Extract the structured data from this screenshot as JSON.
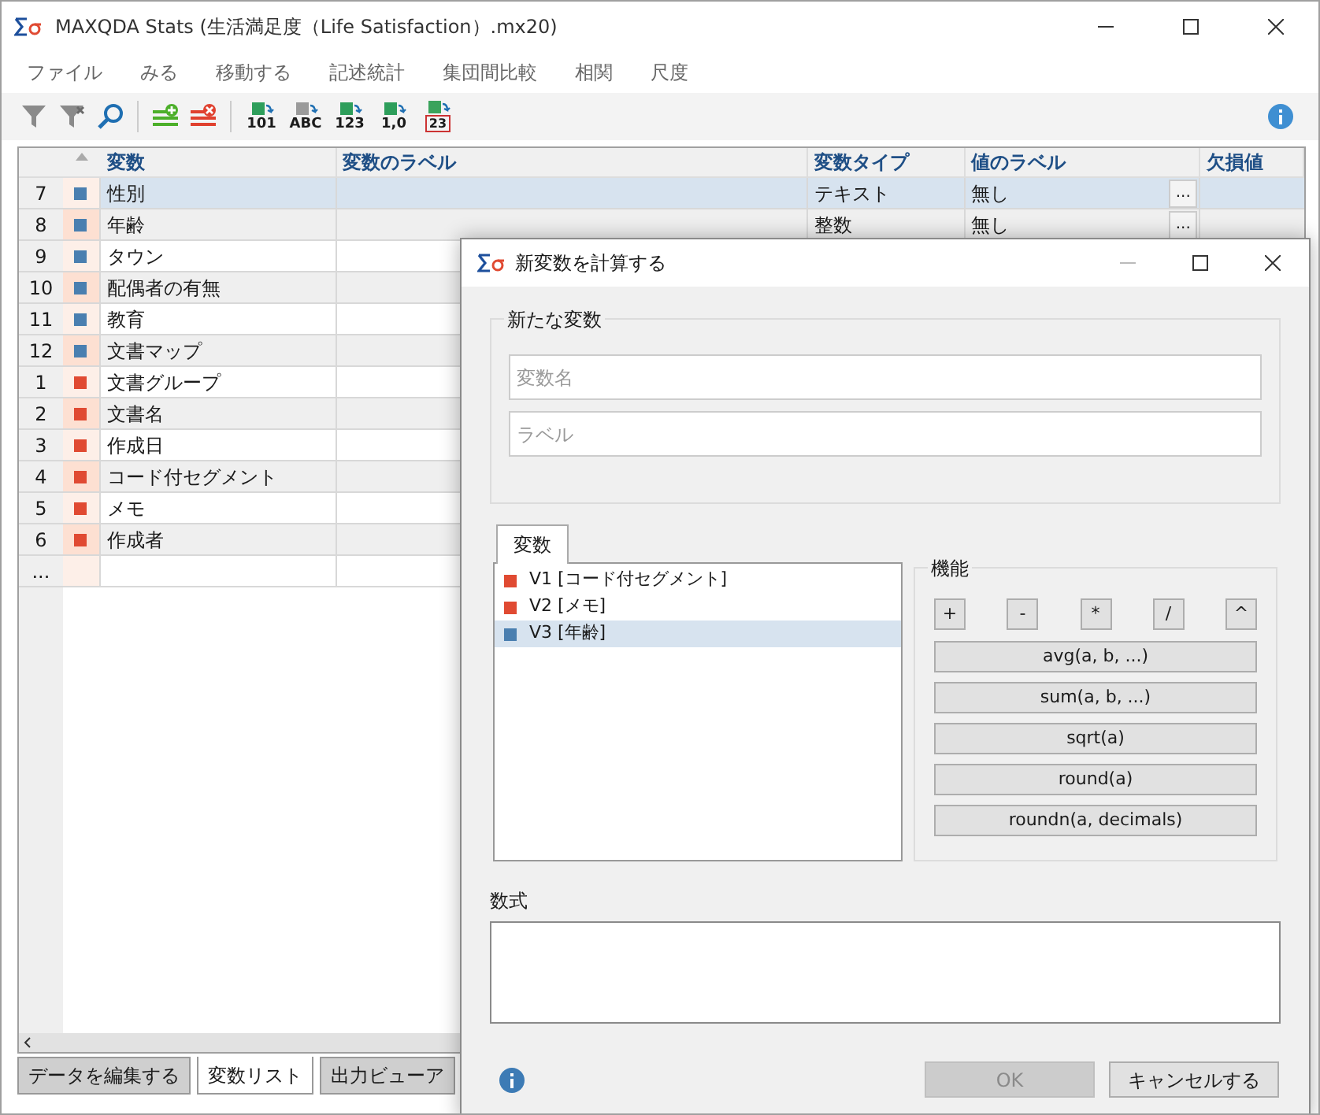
{
  "window": {
    "title": "MAXQDA Stats (生活満足度（Life Satisfaction）.mx20)"
  },
  "menu": [
    "ファイル",
    "みる",
    "移動する",
    "記述統計",
    "集団間比較",
    "相関",
    "尺度"
  ],
  "toolbar": [
    {
      "kind": "filter"
    },
    {
      "kind": "filter-clear"
    },
    {
      "kind": "search"
    },
    {
      "kind": "add"
    },
    {
      "kind": "delete"
    },
    {
      "kind": "convert",
      "label": "101",
      "color": "#2e9e5b"
    },
    {
      "kind": "convert",
      "label": "ABC",
      "color": "#9a9a9a"
    },
    {
      "kind": "convert",
      "label": "123",
      "color": "#2e9e5b"
    },
    {
      "kind": "convert",
      "label": "1,0",
      "color": "#2e9e5b"
    },
    {
      "kind": "date",
      "label": "23"
    }
  ],
  "table": {
    "columns": [
      "変数",
      "変数のラベル",
      "変数タイプ",
      "値のラベル",
      "欠損値"
    ],
    "rows": [
      {
        "num": "7",
        "color": "#4a7fb0",
        "name": "性別",
        "type": "テキスト",
        "value_label": "無し",
        "button": "...",
        "selected": true
      },
      {
        "num": "8",
        "color": "#4a7fb0",
        "name": "年齢",
        "type": "整数",
        "value_label": "無し",
        "button": "...",
        "selected": false
      },
      {
        "num": "9",
        "color": "#4a7fb0",
        "name": "タウン",
        "selected": false
      },
      {
        "num": "10",
        "color": "#4a7fb0",
        "name": "配偶者の有無",
        "selected": false
      },
      {
        "num": "11",
        "color": "#4a7fb0",
        "name": "教育",
        "selected": false
      },
      {
        "num": "12",
        "color": "#4a7fb0",
        "name": "文書マップ",
        "selected": false
      },
      {
        "num": "1",
        "color": "#e04a32",
        "name": "文書グループ",
        "selected": false
      },
      {
        "num": "2",
        "color": "#e04a32",
        "name": "文書名",
        "selected": false
      },
      {
        "num": "3",
        "color": "#e04a32",
        "name": "作成日",
        "selected": false
      },
      {
        "num": "4",
        "color": "#e04a32",
        "name": "コード付セグメント",
        "selected": false
      },
      {
        "num": "5",
        "color": "#e04a32",
        "name": "メモ",
        "selected": false
      },
      {
        "num": "6",
        "color": "#e04a32",
        "name": "作成者",
        "selected": false
      },
      {
        "num": "...",
        "selected": false
      }
    ]
  },
  "bottom_tabs": [
    {
      "label": "データを編集する",
      "selected": false
    },
    {
      "label": "変数リスト",
      "selected": true
    },
    {
      "label": "出力ビューア",
      "selected": false
    }
  ],
  "dialog": {
    "title": "新変数を計算する",
    "group": "新たな変数",
    "name_placeholder": "変数名",
    "label_placeholder": "ラベル",
    "tab": "変数",
    "variables": [
      {
        "label": "V1 [コード付セグメント]",
        "color": "#e04a32",
        "selected": false
      },
      {
        "label": "V2 [メモ]",
        "color": "#e04a32",
        "selected": false
      },
      {
        "label": "V3 [年齢]",
        "color": "#4a7fb0",
        "selected": true
      }
    ],
    "functions_title": "機能",
    "operators": [
      "+",
      "-",
      "*",
      "/",
      "^"
    ],
    "functions": [
      "avg(a, b, ...)",
      "sum(a, b, ...)",
      "sqrt(a)",
      "round(a)",
      "roundn(a, decimals)"
    ],
    "formula_label": "数式",
    "ok": {
      "label": "OK",
      "disabled": true
    },
    "cancel": "キャンセルする"
  }
}
